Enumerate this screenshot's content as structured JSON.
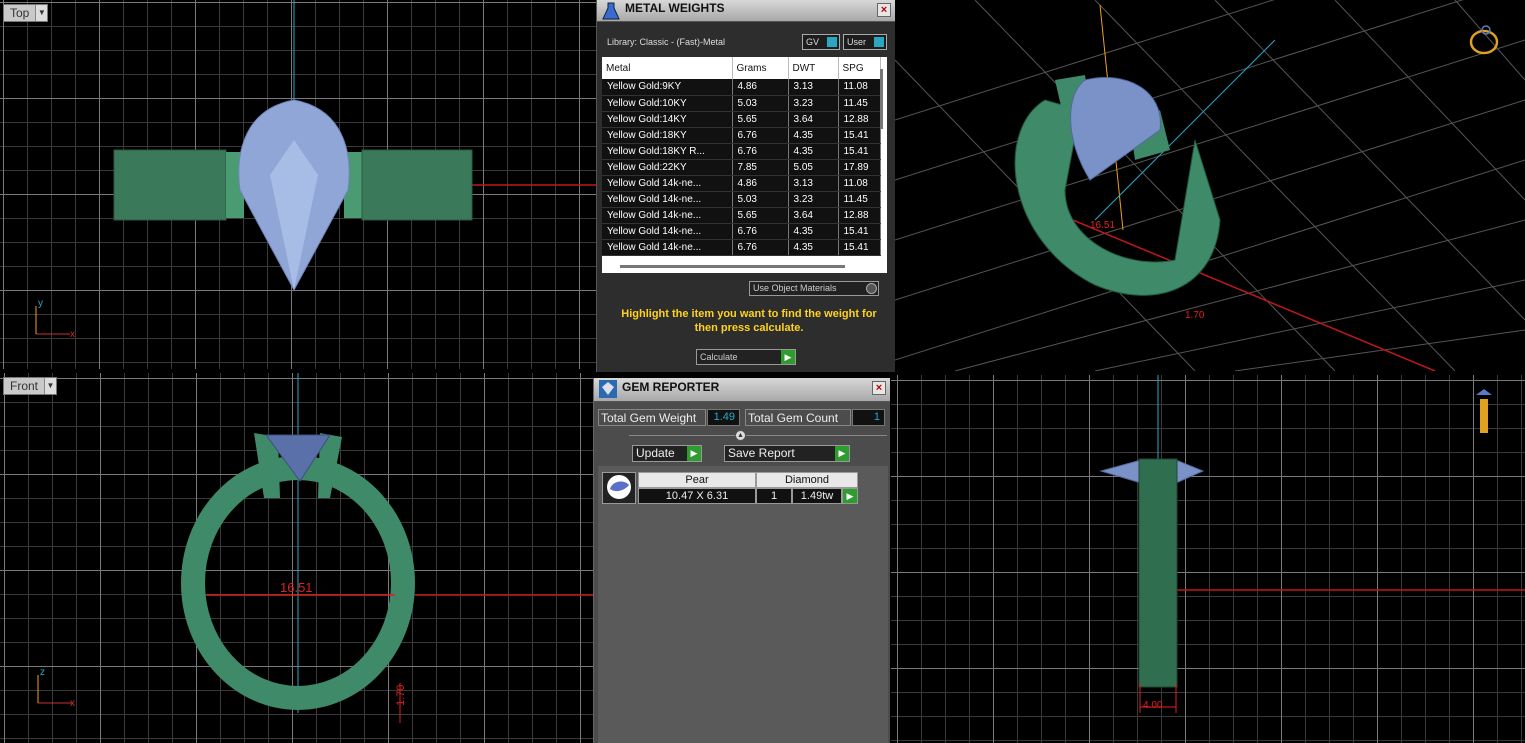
{
  "viewports": {
    "top": {
      "label": "Top",
      "axes": [
        "y",
        "x"
      ]
    },
    "front": {
      "label": "Front",
      "axes": [
        "z",
        "x"
      ],
      "dims": [
        "16.51",
        "1.70"
      ]
    },
    "right": {
      "dims": [
        "4.00"
      ]
    },
    "perspective": {
      "dims": [
        "16.51",
        "1.70"
      ]
    }
  },
  "metal_weights": {
    "title": "METAL WEIGHTS",
    "close": "×",
    "library": "Library: Classic - (Fast)-Metal",
    "toggles": [
      "GV",
      "User"
    ],
    "columns": [
      "Metal",
      "Grams",
      "DWT",
      "SPG"
    ],
    "rows": [
      [
        "Yellow Gold:9KY",
        "4.86",
        "3.13",
        "11.08"
      ],
      [
        "Yellow Gold:10KY",
        "5.03",
        "3.23",
        "11.45"
      ],
      [
        "Yellow Gold:14KY",
        "5.65",
        "3.64",
        "12.88"
      ],
      [
        "Yellow Gold:18KY",
        "6.76",
        "4.35",
        "15.41"
      ],
      [
        "Yellow Gold:18KY R...",
        "6.76",
        "4.35",
        "15.41"
      ],
      [
        "Yellow Gold:22KY",
        "7.85",
        "5.05",
        "17.89"
      ],
      [
        "Yellow Gold 14k-ne...",
        "4.86",
        "3.13",
        "11.08"
      ],
      [
        "Yellow Gold 14k-ne...",
        "5.03",
        "3.23",
        "11.45"
      ],
      [
        "Yellow Gold 14k-ne...",
        "5.65",
        "3.64",
        "12.88"
      ],
      [
        "Yellow Gold 14k-ne...",
        "6.76",
        "4.35",
        "15.41"
      ],
      [
        "Yellow Gold 14k-ne...",
        "6.76",
        "4.35",
        "15.41"
      ]
    ],
    "use_object_materials": "Use Object Materials",
    "hint": "Highlight the item you want to find the weight for then press calculate.",
    "calculate": "Calculate"
  },
  "gem_reporter": {
    "title": "GEM REPORTER",
    "close": "×",
    "total_weight_label": "Total Gem Weight",
    "total_weight": "1.49",
    "total_count_label": "Total Gem Count",
    "total_count": "1",
    "update": "Update",
    "save_report": "Save Report",
    "gem": {
      "shape": "Pear",
      "material": "Diamond",
      "size": "10.47 X 6.31",
      "count": "1",
      "weight": "1.49tw"
    }
  },
  "colors": {
    "ring": "#3e8a69",
    "gem": "#8fa6d6",
    "dim": "#e02020",
    "axis_blue": "#2aa7c3",
    "hint": "#ffd21f"
  }
}
